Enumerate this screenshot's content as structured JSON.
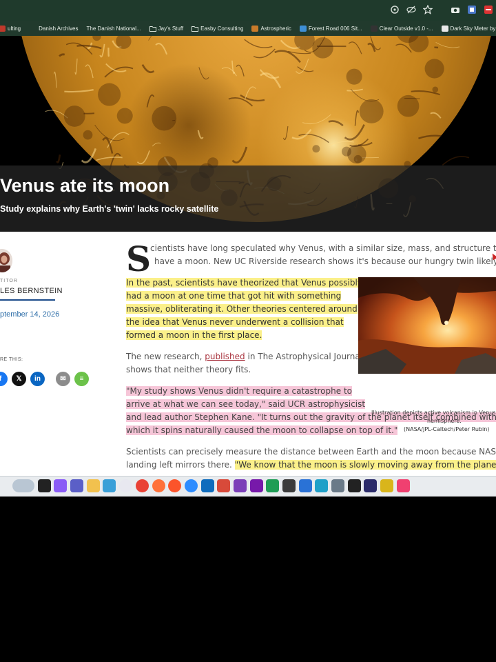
{
  "bookmarks": [
    {
      "label": "ulting",
      "icon": "site-icon",
      "color": "#c0392b"
    },
    {
      "label": "Danish Archives",
      "icon": "none",
      "color": ""
    },
    {
      "label": "The Danish National...",
      "icon": "none",
      "color": ""
    },
    {
      "label": "Jay's Stuff",
      "icon": "folder-icon",
      "color": "#d9e3dc"
    },
    {
      "label": "Easby Consulting",
      "icon": "folder-icon",
      "color": "#d9e3dc"
    },
    {
      "label": "Astrospheric",
      "icon": "site-icon",
      "color": "#c97b2a"
    },
    {
      "label": "Forest Road 006 Sit...",
      "icon": "site-icon",
      "color": "#3e8fd6"
    },
    {
      "label": "Clear Outside v1.0 -...",
      "icon": "site-icon",
      "color": "#333333"
    },
    {
      "label": "Dark Sky Meter by",
      "icon": "site-icon",
      "color": "#e8e8e8"
    }
  ],
  "browser_icons": [
    "eye-icon",
    "eye-off-icon",
    "star-icon",
    "camera-icon",
    "extension-icon",
    "extension-icon-red"
  ],
  "hero": {
    "title": "Venus ate its moon",
    "subtitle": "Study explains why Earth's 'twin' lacks rocky satellite"
  },
  "author": {
    "role": "TITOR",
    "name": "LES BERNSTEIN",
    "date": "ptember 14, 2026"
  },
  "share": {
    "label": "RE THIS:",
    "buttons": [
      {
        "name": "facebook",
        "glyph": "f",
        "color": "#1877f2"
      },
      {
        "name": "x",
        "glyph": "𝕏",
        "color": "#111111"
      },
      {
        "name": "linkedin",
        "glyph": "in",
        "color": "#0a66c2"
      },
      {
        "name": "email",
        "glyph": "✉",
        "color": "#8c8c8c"
      },
      {
        "name": "print",
        "glyph": "≡",
        "color": "#6cc24a"
      }
    ]
  },
  "article": {
    "dropcap": "S",
    "p1": [
      "cientists have long speculated why Venus, with a similar size, mass, and structure to Earth, d",
      "have a moon. New UC Riverside research shows it's because our hungry twin likely swallowed"
    ],
    "p2": [
      "In the past, scientists have theorized that Venus possibly",
      "had a moon at one time that got hit with something",
      "massive, obliterating it. Other theories centered around",
      "the idea that Venus never underwent a collision that",
      "formed a moon in the first place."
    ],
    "p3_pre": "The new research, ",
    "p3_link": "published",
    "p3_post": " in The Astrophysical Journal,",
    "p3_line2": "shows that neither theory fits.",
    "p4": [
      "\"My study shows Venus didn't require a catastrophe to",
      "arrive at what we can see today,\" said UCR astrophysicist",
      "and lead author Stephen Kane. \"It turns out the gravity of the planet itself combined with the rate a",
      "which it spins naturally caused the moon to collapse on top of it.\""
    ],
    "p5_line1": "Scientists can precisely measure the distance between Earth and the moon because NASA's Apollo",
    "p5_line2_plain": "landing left mirrors there. ",
    "p5_line2_hl": "\"We know that the moon is slowly moving away from the planet, at a rate"
  },
  "figure": {
    "caption_line1": "Illustration depicts active volcanism in Venus' so",
    "caption_line2": "hemisphere.",
    "caption_line3": "(NASA/JPL-Caltech/Peter Rubin)"
  },
  "taskbar": {
    "icons": [
      {
        "name": "weather-icon",
        "color": "#b9c6d3"
      },
      {
        "name": "terminal-icon",
        "color": "#222222"
      },
      {
        "name": "copilot-icon",
        "color": "#8a5cf6"
      },
      {
        "name": "teams-icon",
        "color": "#5b5fc7"
      },
      {
        "name": "file-explorer-icon",
        "color": "#f2c14e"
      },
      {
        "name": "photos-icon",
        "color": "#3aa0d8"
      },
      {
        "name": "itunes-icon",
        "color": "#e8e8f0"
      },
      {
        "name": "chrome-icon",
        "color": "#e94235"
      },
      {
        "name": "firefox-icon",
        "color": "#ff7139"
      },
      {
        "name": "brave-icon",
        "color": "#fb542b"
      },
      {
        "name": "zoom-icon",
        "color": "#2d8cff"
      },
      {
        "name": "outlook-icon",
        "color": "#0f6cbd"
      },
      {
        "name": "photo-app-icon",
        "color": "#d84a3a"
      },
      {
        "name": "onenote-alt-icon",
        "color": "#7b3fb8"
      },
      {
        "name": "onenote-icon",
        "color": "#7719aa"
      },
      {
        "name": "excel-icon",
        "color": "#1f9d55"
      },
      {
        "name": "app-dark-icon",
        "color": "#3b3b3b"
      },
      {
        "name": "info-icon",
        "color": "#2a72d6"
      },
      {
        "name": "edge-icon",
        "color": "#1fa0c8"
      },
      {
        "name": "stellarium-icon",
        "color": "#6a7a88"
      },
      {
        "name": "qr-app-icon",
        "color": "#222222"
      },
      {
        "name": "media-icon",
        "color": "#2b2b6a"
      },
      {
        "name": "pen-icon",
        "color": "#d9b51b"
      },
      {
        "name": "music-icon",
        "color": "#f04070"
      }
    ]
  }
}
